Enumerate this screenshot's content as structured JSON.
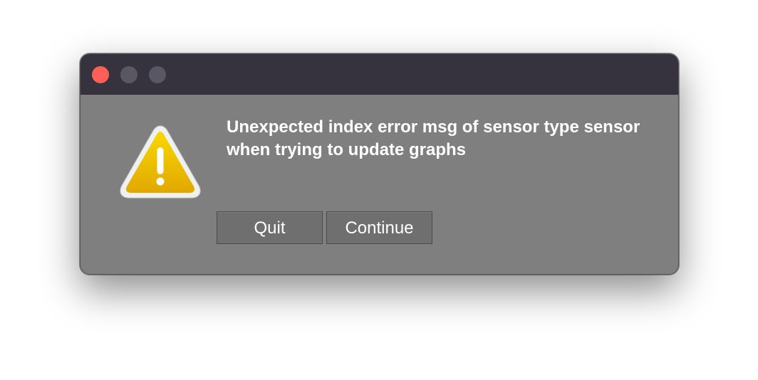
{
  "window": {
    "controls": [
      "close",
      "minimize",
      "zoom"
    ]
  },
  "alert": {
    "icon": "warning-icon",
    "message": "Unexpected index error msg of sensor type sensor when trying to update graphs"
  },
  "buttons": {
    "quit_label": "Quit",
    "continue_label": "Continue"
  },
  "colors": {
    "titlebar": "#36333e",
    "body": "#7f7f7f",
    "close": "#fe5f57",
    "warning_fill": "#f2c200"
  }
}
